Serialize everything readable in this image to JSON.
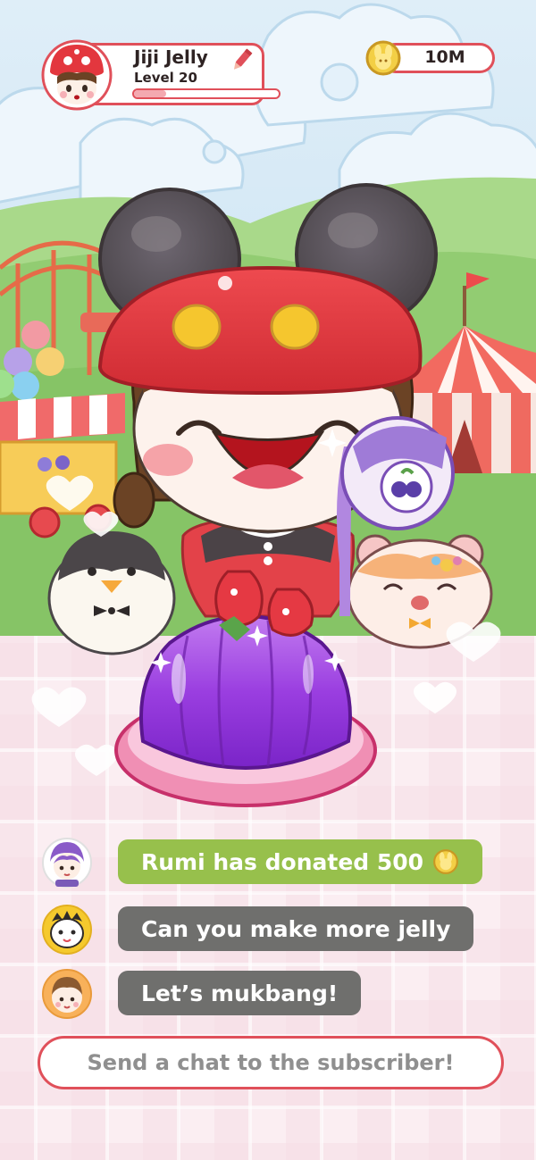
{
  "player": {
    "name": "Jiji Jelly",
    "level": "Level 20",
    "xp_progress": 0.22
  },
  "currency": {
    "amount": "10M",
    "icon": "bunny-coin-icon"
  },
  "chat": {
    "messages": [
      {
        "text": "Rumi has donated 500",
        "type": "donation",
        "coin_icon": "bunny-coin-icon"
      },
      {
        "text": "Can you make more jelly",
        "type": "message"
      },
      {
        "text": "Let’s mukbang!",
        "type": "message"
      }
    ],
    "input_placeholder": "Send a chat to the subscriber!"
  },
  "colors": {
    "accent": "#e0505a",
    "donation_bubble": "#97c04c",
    "message_bubble": "#6f6f6d",
    "jelly": "#9b3fd6",
    "hat": "#e3373e"
  }
}
